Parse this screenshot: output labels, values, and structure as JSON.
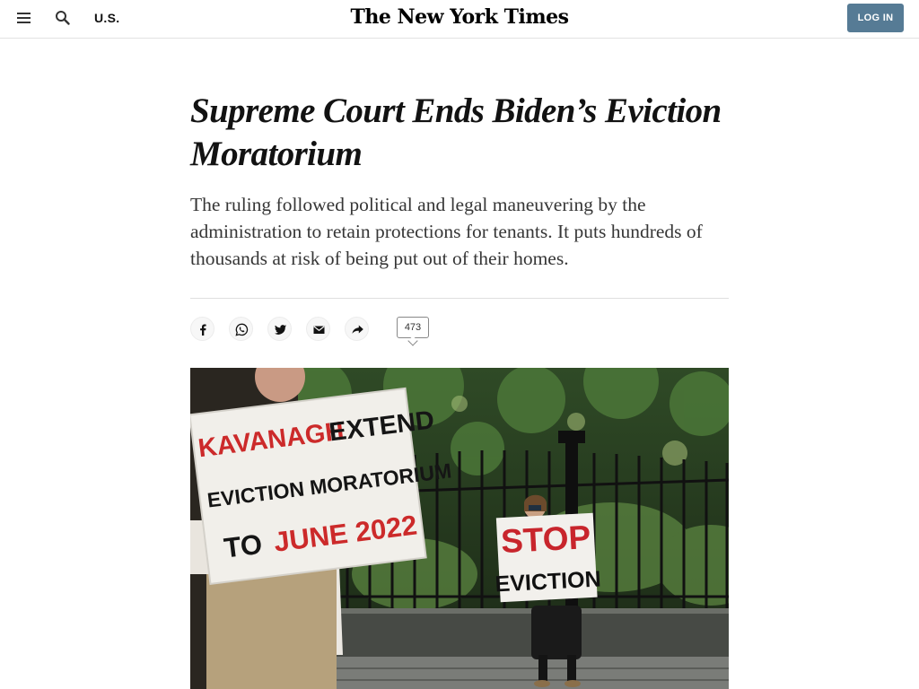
{
  "header": {
    "menu_icon": "hamburger-menu-icon",
    "search_icon": "search-icon",
    "section": "U.S.",
    "logo": "The New York Times",
    "login_label": "LOG IN",
    "login_color": "#567b95"
  },
  "article": {
    "headline": "Supreme Court Ends Biden’s Eviction Moratorium",
    "summary": "The ruling followed political and legal maneuvering by the administration to retain protections for tenants. It puts hundreds of thousands at risk of being put out of their homes."
  },
  "share": {
    "buttons": [
      {
        "icon": "facebook-icon"
      },
      {
        "icon": "whatsapp-icon"
      },
      {
        "icon": "twitter-icon"
      },
      {
        "icon": "email-icon"
      },
      {
        "icon": "share-arrow-icon"
      }
    ],
    "comment_count": "473"
  },
  "photo": {
    "sign_left_line1a": "KAVANAGH",
    "sign_left_line1b": "EXTEND",
    "sign_left_line2": "EVICTION MORATORIUM",
    "sign_left_line3a": "TO",
    "sign_left_line3b": "JUNE 2022",
    "sign_right_line1": "STOP",
    "sign_right_line2": "EVICTION"
  }
}
